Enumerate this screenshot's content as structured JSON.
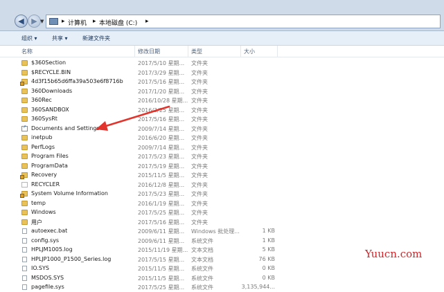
{
  "breadcrumb": {
    "seg1": "计算机",
    "seg2": "本地磁盘 (C:)"
  },
  "toolbar": {
    "organize": "组织 ▾",
    "share": "共享 ▾",
    "new_folder": "新建文件夹"
  },
  "columns": {
    "name": "名称",
    "date": "修改日期",
    "type": "类型",
    "size": "大小"
  },
  "files": [
    {
      "name": "$360Section",
      "date": "2017/5/10 星期...",
      "type": "文件夹",
      "size": "",
      "icon": "folder-icon"
    },
    {
      "name": "$RECYCLE.BIN",
      "date": "2017/3/29 星期...",
      "type": "文件夹",
      "size": "",
      "icon": "folder-icon"
    },
    {
      "name": "4d3f15b65d6ffa39a503e6f8716b",
      "date": "2017/5/16 星期...",
      "type": "文件夹",
      "size": "",
      "icon": "locked-folder-icon"
    },
    {
      "name": "360Downloads",
      "date": "2017/1/20 星期...",
      "type": "文件夹",
      "size": "",
      "icon": "folder-icon"
    },
    {
      "name": "360Rec",
      "date": "2016/10/28 星期...",
      "type": "文件夹",
      "size": "",
      "icon": "folder-icon"
    },
    {
      "name": "360SANDBOX",
      "date": "2016/3/25 星期...",
      "type": "文件夹",
      "size": "",
      "icon": "folder-icon"
    },
    {
      "name": "360SysRt",
      "date": "2017/5/16 星期...",
      "type": "文件夹",
      "size": "",
      "icon": "folder-icon"
    },
    {
      "name": "Documents and Settings",
      "date": "2009/7/14 星期...",
      "type": "文件夹",
      "size": "",
      "icon": "shortcut-icon"
    },
    {
      "name": "inetpub",
      "date": "2016/6/20 星期...",
      "type": "文件夹",
      "size": "",
      "icon": "folder-icon"
    },
    {
      "name": "PerfLogs",
      "date": "2009/7/14 星期...",
      "type": "文件夹",
      "size": "",
      "icon": "folder-icon"
    },
    {
      "name": "Program Files",
      "date": "2017/5/23 星期...",
      "type": "文件夹",
      "size": "",
      "icon": "folder-icon"
    },
    {
      "name": "ProgramData",
      "date": "2017/5/19 星期...",
      "type": "文件夹",
      "size": "",
      "icon": "folder-icon"
    },
    {
      "name": "Recovery",
      "date": "2015/11/5 星期...",
      "type": "文件夹",
      "size": "",
      "icon": "locked-folder-icon"
    },
    {
      "name": "RECYCLER",
      "date": "2016/12/8 星期...",
      "type": "文件夹",
      "size": "",
      "icon": "recycler-icon"
    },
    {
      "name": "System Volume Information",
      "date": "2017/5/23 星期...",
      "type": "文件夹",
      "size": "",
      "icon": "locked-folder-icon"
    },
    {
      "name": "temp",
      "date": "2016/1/19 星期...",
      "type": "文件夹",
      "size": "",
      "icon": "folder-icon"
    },
    {
      "name": "Windows",
      "date": "2017/5/25 星期...",
      "type": "文件夹",
      "size": "",
      "icon": "folder-icon"
    },
    {
      "name": "用户",
      "date": "2017/5/16 星期...",
      "type": "文件夹",
      "size": "",
      "icon": "folder-icon"
    },
    {
      "name": "autoexec.bat",
      "date": "2009/6/11 星期...",
      "type": "Windows 批处理...",
      "size": "1 KB",
      "icon": "file-icon"
    },
    {
      "name": "config.sys",
      "date": "2009/6/11 星期...",
      "type": "系统文件",
      "size": "1 KB",
      "icon": "file-icon"
    },
    {
      "name": "HPLJM1005.log",
      "date": "2015/11/19 星期...",
      "type": "文本文档",
      "size": "5 KB",
      "icon": "file-icon"
    },
    {
      "name": "HPLJP1000_P1500_Series.log",
      "date": "2017/5/15 星期...",
      "type": "文本文档",
      "size": "76 KB",
      "icon": "file-icon"
    },
    {
      "name": "IO.SYS",
      "date": "2015/11/5 星期...",
      "type": "系统文件",
      "size": "0 KB",
      "icon": "file-icon"
    },
    {
      "name": "MSDOS.SYS",
      "date": "2015/11/5 星期...",
      "type": "系统文件",
      "size": "0 KB",
      "icon": "file-icon"
    },
    {
      "name": "pagefile.sys",
      "date": "2017/5/25 星期...",
      "type": "系统文件",
      "size": "3,135,944...",
      "icon": "file-icon"
    }
  ],
  "watermark": "Yuucn.com",
  "colors": {
    "annotation_arrow": "#e0342c",
    "watermark": "#d0262a"
  }
}
